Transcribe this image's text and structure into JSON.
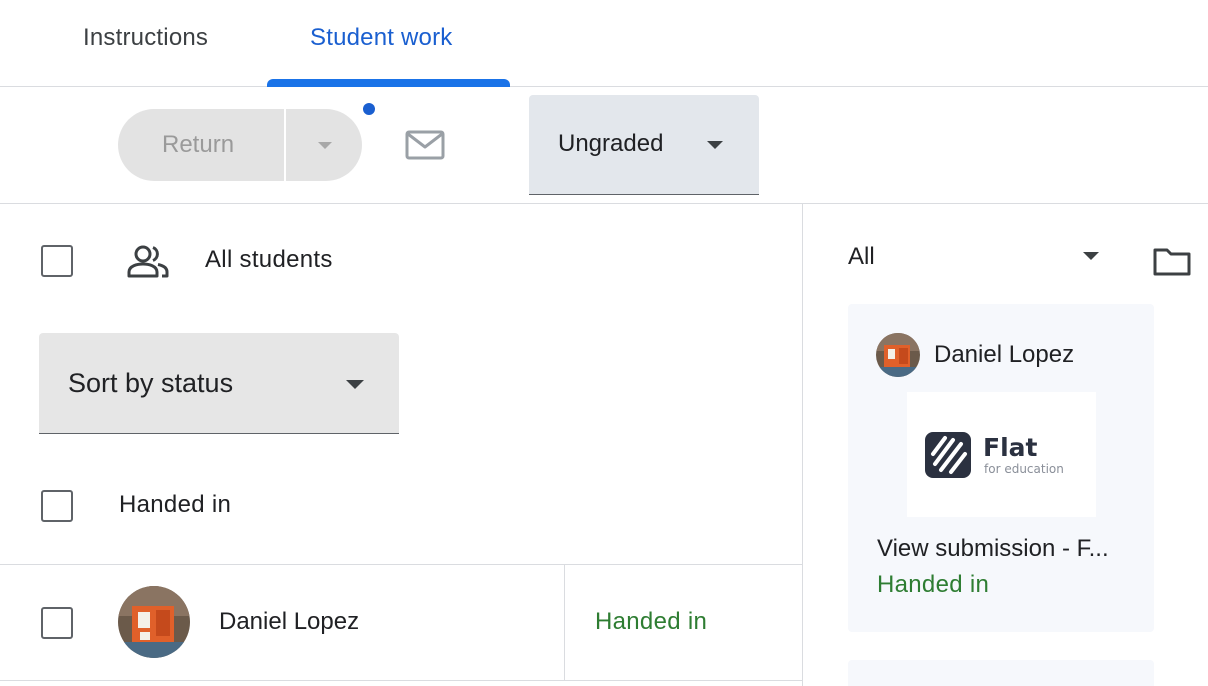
{
  "tabs": {
    "instructions": "Instructions",
    "student_work": "Student work",
    "active": "student_work"
  },
  "toolbar": {
    "return_label": "Return",
    "grade_filter": "Ungraded"
  },
  "roster": {
    "all_label": "All students",
    "sort_label": "Sort by status",
    "groups": [
      {
        "label": "Handed in",
        "students": [
          {
            "name": "Daniel Lopez",
            "status": "Handed in"
          }
        ]
      }
    ]
  },
  "submissions": {
    "filter": "All",
    "cards": [
      {
        "student": "Daniel Lopez",
        "thumbnail_title": "Flat",
        "thumbnail_subtitle": "for education",
        "link": "View submission - F...",
        "status": "Handed in"
      }
    ]
  },
  "colors": {
    "accent": "#1a73e8",
    "status_green": "#2e7d32",
    "notification_dot": "#1a5fd0"
  }
}
